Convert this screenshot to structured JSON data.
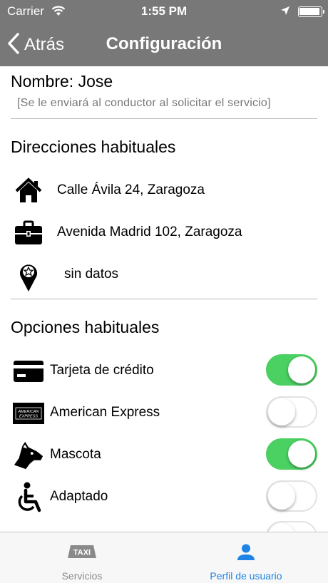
{
  "status_bar": {
    "carrier": "Carrier",
    "time": "1:55 PM"
  },
  "nav": {
    "back_label": "Atrás",
    "title": "Configuración"
  },
  "profile": {
    "name": "Nombre: Jose",
    "hint": "[Se le enviará al conductor al solicitar el servicio]"
  },
  "addresses": {
    "title": "Direcciones habituales",
    "items": [
      {
        "icon": "home-icon",
        "label": "Calle Ávila 24, Zaragoza"
      },
      {
        "icon": "briefcase-icon",
        "label": "Avenida Madrid 102, Zaragoza"
      },
      {
        "icon": "map-pin-star-icon",
        "label": "sin datos"
      }
    ]
  },
  "options": {
    "title": "Opciones habituales",
    "items": [
      {
        "icon": "credit-card-icon",
        "label": "Tarjeta de crédito",
        "enabled": true
      },
      {
        "icon": "american-express-icon",
        "label": "American Express",
        "enabled": false
      },
      {
        "icon": "dog-icon",
        "label": "Mascota",
        "enabled": true
      },
      {
        "icon": "wheelchair-icon",
        "label": "Adaptado",
        "enabled": false
      }
    ]
  },
  "amex_card_text": [
    "AMERICAN",
    "EXPRESS"
  ],
  "tabs": [
    {
      "label": "Servicios",
      "icon": "taxi-icon",
      "icon_text": "TAXI",
      "active": false
    },
    {
      "label": "Perfil de usuario",
      "icon": "user-icon",
      "active": true
    }
  ],
  "colors": {
    "header": "#787878",
    "toggle_on": "#4bd062",
    "tab_active": "#1e84e6",
    "tab_inactive": "#8a8a8a"
  }
}
